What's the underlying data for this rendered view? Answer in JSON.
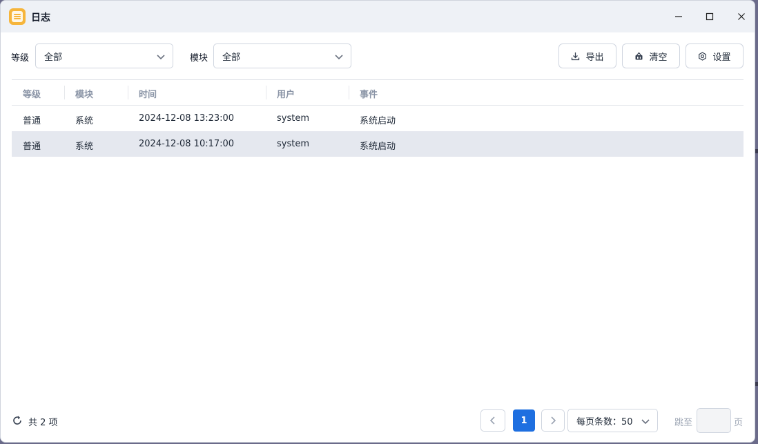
{
  "window": {
    "title": "日志"
  },
  "filters": {
    "level_label": "等级",
    "level_value": "全部",
    "module_label": "模块",
    "module_value": "全部"
  },
  "toolbar": {
    "export_label": "导出",
    "clear_label": "清空",
    "settings_label": "设置"
  },
  "table": {
    "columns": [
      "等级",
      "模块",
      "时间",
      "用户",
      "事件"
    ],
    "rows": [
      [
        "普通",
        "系统",
        "2024-12-08 13:23:00",
        "system",
        "系统启动"
      ],
      [
        "普通",
        "系统",
        "2024-12-08 10:17:00",
        "system",
        "系统启动"
      ]
    ],
    "selected_row": 1
  },
  "footer": {
    "total_text": "共 2 项",
    "current_page": "1",
    "page_size_text": "每页条数：50",
    "jump_label": "跳至",
    "jump_value": "",
    "jump_suffix": "页"
  },
  "icons": {
    "app": "log-app-icon",
    "minimize": "minimize-icon",
    "maximize": "maximize-icon",
    "close": "close-icon",
    "dropdown": "chevron-down-icon",
    "export": "download-icon",
    "clear": "basket-icon",
    "settings": "gear-icon",
    "refresh": "refresh-icon",
    "prev": "chevron-left-icon",
    "next": "chevron-right-icon"
  },
  "colors": {
    "accent": "#1e6fe0",
    "titlebar": "#eef1f6",
    "selected_row": "#e5e8ef",
    "app_icon": "#f6b53b"
  }
}
